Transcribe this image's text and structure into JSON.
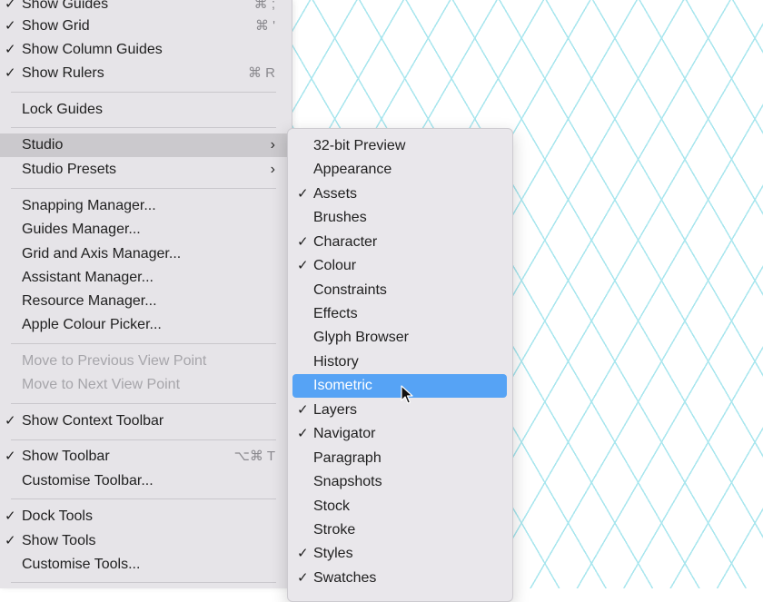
{
  "colors": {
    "menu_bg": "#e6e4e8",
    "highlight": "#56a3f5",
    "grid_line": "#a8e6ee",
    "disabled_text": "#a6a5aa"
  },
  "check_glyph": "✓",
  "submenu_arrow": "›",
  "menu": {
    "items": [
      {
        "label": "Show Guides",
        "checked": true,
        "shortcut": "⌘ ;"
      },
      {
        "label": "Show Grid",
        "checked": true,
        "shortcut": "⌘ '"
      },
      {
        "label": "Show Column Guides",
        "checked": true
      },
      {
        "label": "Show Rulers",
        "checked": true,
        "shortcut": "⌘ R"
      },
      {
        "label": "Lock Guides",
        "checked": false
      },
      {
        "label": "Studio",
        "checked": false,
        "submenu": true
      },
      {
        "label": "Studio Presets",
        "checked": false,
        "submenu": true
      },
      {
        "label": "Snapping Manager...",
        "checked": false
      },
      {
        "label": "Guides Manager...",
        "checked": false
      },
      {
        "label": "Grid and Axis Manager...",
        "checked": false
      },
      {
        "label": "Assistant Manager...",
        "checked": false
      },
      {
        "label": "Resource Manager...",
        "checked": false
      },
      {
        "label": "Apple Colour Picker...",
        "checked": false
      },
      {
        "label": "Move to Previous View Point",
        "checked": false,
        "disabled": true
      },
      {
        "label": "Move to Next View Point",
        "checked": false,
        "disabled": true
      },
      {
        "label": "Show Context Toolbar",
        "checked": true
      },
      {
        "label": "Show Toolbar",
        "checked": true,
        "shortcut": "⌥⌘ T"
      },
      {
        "label": "Customise Toolbar...",
        "checked": false
      },
      {
        "label": "Dock Tools",
        "checked": true
      },
      {
        "label": "Show Tools",
        "checked": true
      },
      {
        "label": "Customise Tools...",
        "checked": false
      }
    ]
  },
  "studio_submenu": {
    "items": [
      {
        "label": "32-bit Preview",
        "checked": false
      },
      {
        "label": "Appearance",
        "checked": false
      },
      {
        "label": "Assets",
        "checked": true
      },
      {
        "label": "Brushes",
        "checked": false
      },
      {
        "label": "Character",
        "checked": true
      },
      {
        "label": "Colour",
        "checked": true
      },
      {
        "label": "Constraints",
        "checked": false
      },
      {
        "label": "Effects",
        "checked": false
      },
      {
        "label": "Glyph Browser",
        "checked": false
      },
      {
        "label": "History",
        "checked": false
      },
      {
        "label": "Isometric",
        "checked": false,
        "selected": true
      },
      {
        "label": "Layers",
        "checked": true
      },
      {
        "label": "Navigator",
        "checked": true
      },
      {
        "label": "Paragraph",
        "checked": false
      },
      {
        "label": "Snapshots",
        "checked": false
      },
      {
        "label": "Stock",
        "checked": false
      },
      {
        "label": "Stroke",
        "checked": false
      },
      {
        "label": "Styles",
        "checked": true
      },
      {
        "label": "Swatches",
        "checked": true
      }
    ]
  }
}
